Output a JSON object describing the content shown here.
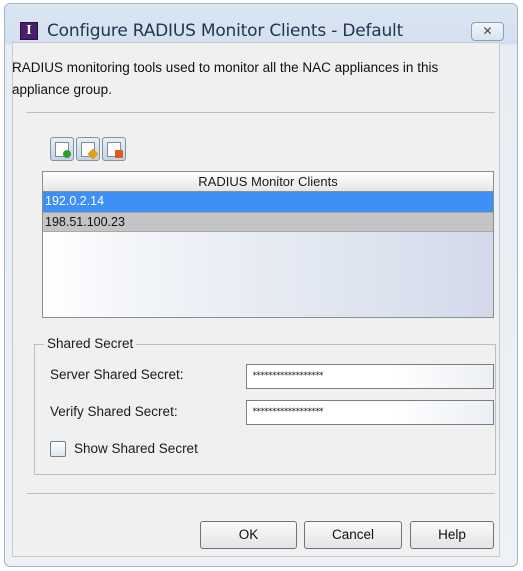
{
  "window": {
    "title": "Configure RADIUS Monitor Clients - Default",
    "app_icon_glyph": "I",
    "close_glyph": "✕"
  },
  "description": "RADIUS monitoring tools used to monitor all the NAC appliances in this appliance group.",
  "toolbar": {
    "buttons": [
      {
        "icon": "add-client-icon",
        "badge_color": "#2e9d2e"
      },
      {
        "icon": "edit-client-icon",
        "badge_color": "#e0a21c"
      },
      {
        "icon": "delete-client-icon",
        "badge_color": "#e05a1c"
      }
    ]
  },
  "clients_table": {
    "header": "RADIUS Monitor Clients",
    "rows": [
      "192.0.2.14",
      "198.51.100.23"
    ],
    "selected_index": 0
  },
  "shared_secret": {
    "legend": "Shared Secret",
    "server_label": "Server Shared Secret:",
    "server_value": "******************",
    "verify_label": "Verify Shared Secret:",
    "verify_value": "******************",
    "show_label": "Show Shared Secret",
    "show_checked": false
  },
  "buttons": {
    "ok": "OK",
    "cancel": "Cancel",
    "help": "Help"
  },
  "colors": {
    "selection": "#3d8ff4",
    "title_text": "#23364f"
  }
}
